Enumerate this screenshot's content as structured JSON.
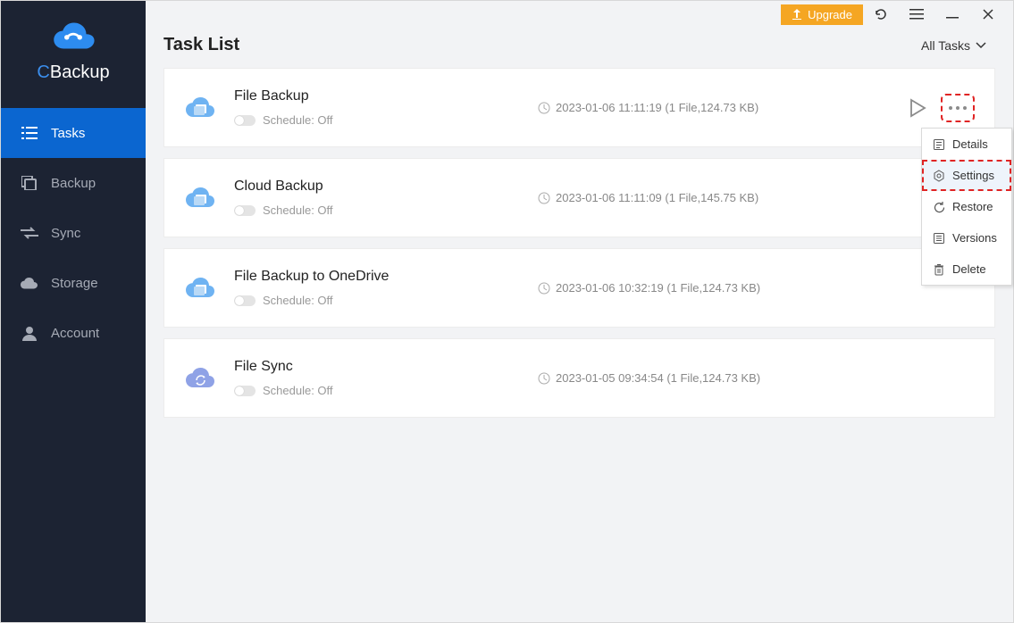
{
  "brand": {
    "c": "C",
    "rest": "Backup"
  },
  "nav": {
    "tasks": "Tasks",
    "backup": "Backup",
    "sync": "Sync",
    "storage": "Storage",
    "account": "Account"
  },
  "titlebar": {
    "upgrade": "Upgrade"
  },
  "page_title": "Task List",
  "filter_label": "All Tasks",
  "schedule_off": "Schedule: Off",
  "tasks": [
    {
      "name": "File Backup",
      "meta": "2023-01-06 11:11:19 (1 File,124.73 KB)",
      "icon": "cloud-file"
    },
    {
      "name": "Cloud Backup",
      "meta": "2023-01-06 11:11:09 (1 File,145.75 KB)",
      "icon": "cloud-file"
    },
    {
      "name": "File Backup to OneDrive",
      "meta": "2023-01-06 10:32:19 (1 File,124.73 KB)",
      "icon": "cloud-file"
    },
    {
      "name": "File Sync",
      "meta": "2023-01-05 09:34:54 (1 File,124.73 KB)",
      "icon": "cloud-sync"
    }
  ],
  "context_menu": {
    "details": "Details",
    "settings": "Settings",
    "restore": "Restore",
    "versions": "Versions",
    "delete": "Delete"
  }
}
